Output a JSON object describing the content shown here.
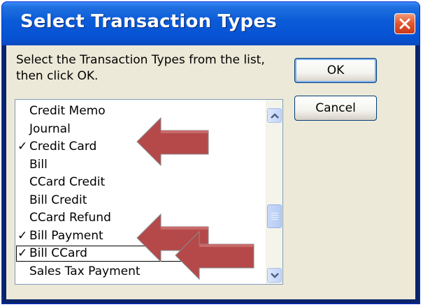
{
  "window": {
    "title": "Select Transaction Types",
    "close_icon": "close-icon"
  },
  "instructions": "Select the Transaction Types from the list, then click OK.",
  "buttons": {
    "ok_label": "OK",
    "cancel_label": "Cancel"
  },
  "list": {
    "items": [
      {
        "label": "Credit Memo",
        "checked": false
      },
      {
        "label": "Journal",
        "checked": false
      },
      {
        "label": "Credit Card",
        "checked": true
      },
      {
        "label": "Bill",
        "checked": false
      },
      {
        "label": "CCard Credit",
        "checked": false
      },
      {
        "label": "Bill Credit",
        "checked": false
      },
      {
        "label": "CCard Refund",
        "checked": false
      },
      {
        "label": "Bill Payment",
        "checked": true
      },
      {
        "label": "Bill CCard",
        "checked": true,
        "focused": true
      },
      {
        "label": "Sales Tax Payment",
        "checked": false
      }
    ],
    "check_mark": "✓"
  },
  "colors": {
    "title_bar": "#0a5ad7",
    "dialog_bg": "#ece9d8",
    "annotation_arrow": "#b5494a"
  }
}
